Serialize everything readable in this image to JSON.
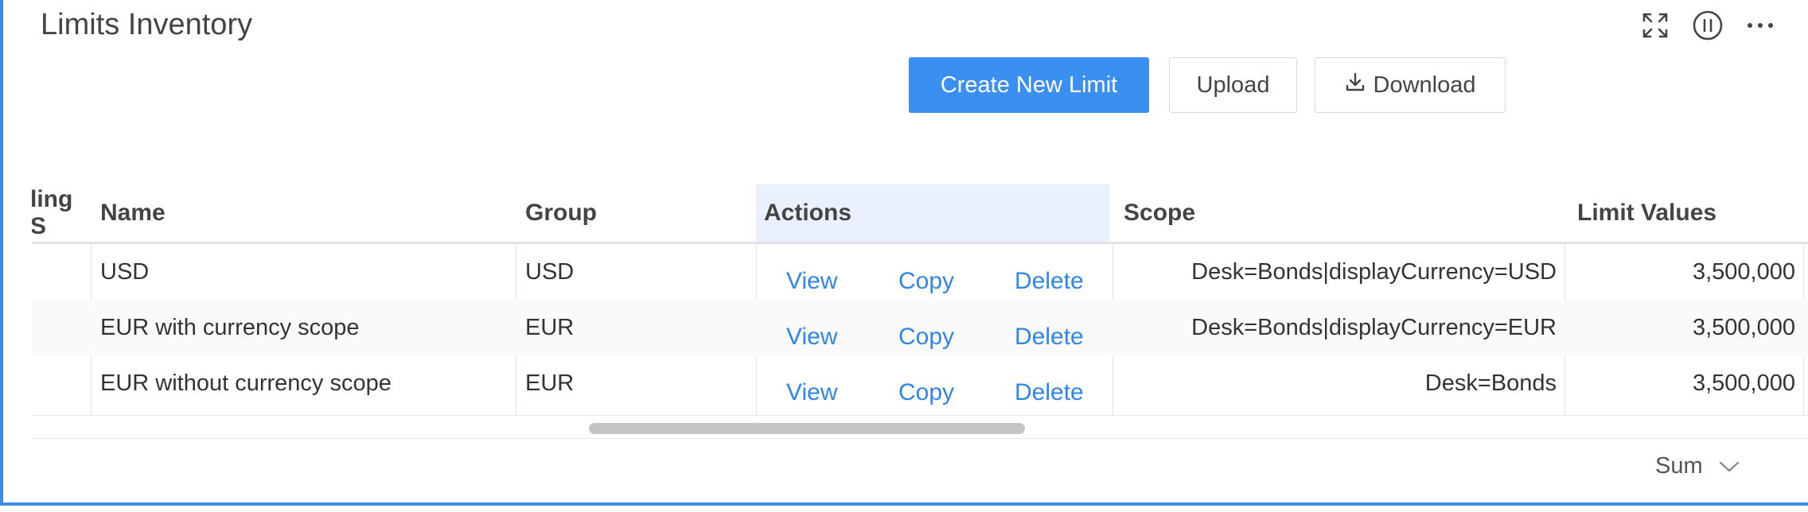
{
  "window": {
    "title": "Limits Inventory"
  },
  "toolbar": {
    "create_label": "Create New Limit",
    "upload_label": "Upload",
    "download_label": "Download"
  },
  "table": {
    "columns": [
      "ling S",
      "Name",
      "Group",
      "Actions",
      "Scope",
      "Limit Values"
    ],
    "rows": [
      {
        "name": "USD",
        "group": "USD",
        "actions": [
          "View",
          "Copy",
          "Delete"
        ],
        "scope": "Desk=Bonds|displayCurrency=USD",
        "limit": "3,500,000"
      },
      {
        "name": "EUR with currency scope",
        "group": "EUR",
        "actions": [
          "View",
          "Copy",
          "Delete"
        ],
        "scope": "Desk=Bonds|displayCurrency=EUR",
        "limit": "3,500,000"
      },
      {
        "name": "EUR without currency scope",
        "group": "EUR",
        "actions": [
          "View",
          "Copy",
          "Delete"
        ],
        "scope": "Desk=Bonds",
        "limit": "3,500,000"
      }
    ]
  },
  "footer": {
    "aggregate": "Sum"
  },
  "colors": {
    "accent": "#3a8ff0",
    "link": "#2e86e8",
    "frame": "#3d8ae6",
    "actions_header_bg": "#eaf1fc"
  },
  "icons": [
    "expand-icon",
    "pause-icon",
    "more-icon",
    "download-icon",
    "chevron-down-icon"
  ]
}
